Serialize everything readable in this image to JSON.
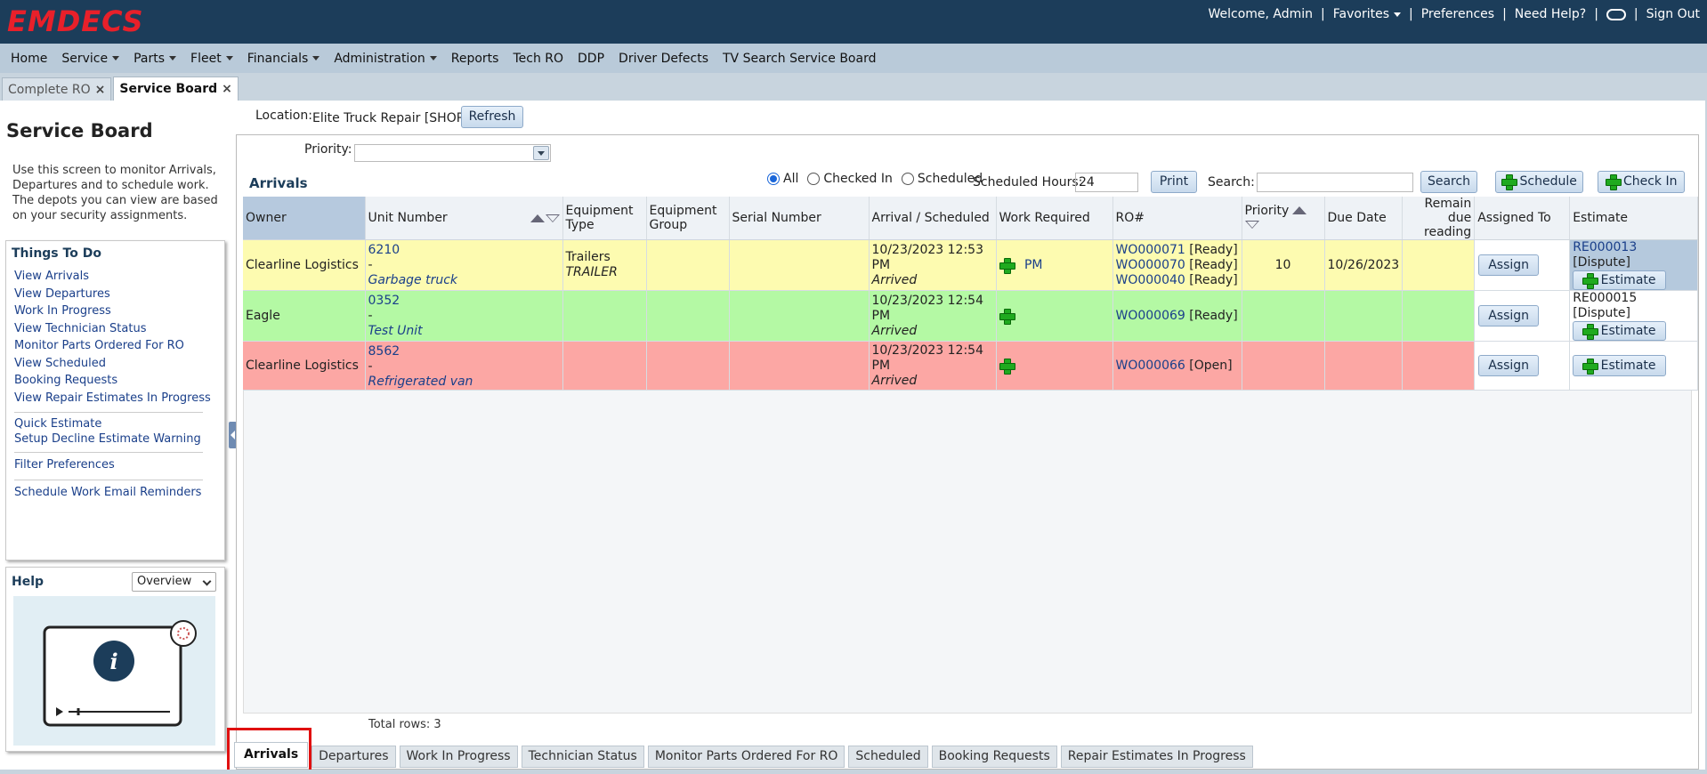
{
  "header": {
    "logo_text": "EMDECS",
    "welcome": "Welcome, Admin",
    "favorites": "Favorites",
    "preferences": "Preferences",
    "need_help": "Need Help?",
    "sign_out": "Sign Out"
  },
  "menu": {
    "home": "Home",
    "service": "Service",
    "parts": "Parts",
    "fleet": "Fleet",
    "financials": "Financials",
    "administration": "Administration",
    "reports": "Reports",
    "tech_ro": "Tech RO",
    "ddp": "DDP",
    "driver_defects": "Driver Defects",
    "tv_search": "TV Search Service Board"
  },
  "doc_tabs": {
    "complete_ro": "Complete RO",
    "service_board": "Service Board",
    "close": "×"
  },
  "left_panel": {
    "title": "Service Board",
    "description": "Use this screen to monitor Arrivals, Departures and to schedule work. The depots you can view are based on your security assignments.",
    "todo_title": "Things To Do",
    "links": {
      "view_arrivals": "View Arrivals",
      "view_departures": "View Departures",
      "work_in_progress": "Work In Progress",
      "view_tech_status": "View Technician Status",
      "monitor_parts": "Monitor Parts Ordered For RO",
      "view_scheduled": "View Scheduled",
      "booking_requests": "Booking Requests",
      "view_repair_estimates": "View Repair Estimates In Progress",
      "quick_estimate": "Quick Estimate",
      "setup_decline": "Setup Decline Estimate Warning",
      "filter_prefs": "Filter Preferences",
      "schedule_email": "Schedule Work Email Reminders"
    },
    "help_title": "Help",
    "help_select": "Overview"
  },
  "toolbar": {
    "location_label": "Location:",
    "location_value": "Elite Truck Repair [SHOP]",
    "refresh": "Refresh",
    "priority_label": "Priority:",
    "arrivals_title": "Arrivals",
    "radio_all": "All",
    "radio_checked_in": "Checked In",
    "radio_scheduled": "Scheduled",
    "scheduled_hours_label": "Scheduled Hours:",
    "scheduled_hours_value": "24",
    "print": "Print",
    "search_label": "Search:",
    "search_button": "Search",
    "schedule_button": "Schedule",
    "checkin_button": "Check In"
  },
  "table": {
    "columns": {
      "owner": "Owner",
      "unit_number": "Unit Number",
      "equipment_type": "Equipment Type",
      "equipment_group": "Equipment Group",
      "serial_number": "Serial Number",
      "arrival": "Arrival / Scheduled",
      "work_required": "Work Required",
      "ro": "RO#",
      "priority": "Priority",
      "due_date": "Due Date",
      "remain_due": "Remain due reading",
      "assigned_to": "Assigned To",
      "estimate": "Estimate"
    },
    "assign_label": "Assign",
    "estimate_label": "Estimate",
    "rows": [
      {
        "owner": "Clearline Logistics",
        "unit": "6210",
        "dash": "-",
        "unit_desc": "Garbage truck",
        "equip_type": "Trailers",
        "equip_type2": "TRAILER",
        "arrival": "10/23/2023 12:53 PM",
        "status": "Arrived",
        "work": "PM",
        "ro1": "WO000071",
        "ro1_status": "[Ready]",
        "ro2": "WO000070",
        "ro2_status": "[Ready]",
        "ro3": "WO000040",
        "ro3_status": "[Ready]",
        "priority": "10",
        "due_date": "10/26/2023",
        "est_id": "RE000013",
        "est_status": "[Dispute]"
      },
      {
        "owner": "Eagle",
        "unit": "0352",
        "dash": "-",
        "unit_desc": "Test Unit",
        "arrival": "10/23/2023 12:54 PM",
        "status": "Arrived",
        "ro1": "WO000069",
        "ro1_status": "[Ready]",
        "est_id": "RE000015",
        "est_status": "[Dispute]"
      },
      {
        "owner": "Clearline Logistics",
        "unit": "8562",
        "dash": "-",
        "unit_desc": "Refrigerated van",
        "arrival": "10/23/2023 12:54 PM",
        "status": "Arrived",
        "ro1": "WO000066",
        "ro1_status": "[Open]"
      }
    ],
    "total_rows": "Total rows:  3"
  },
  "bottom_tabs": {
    "arrivals": "Arrivals",
    "departures": "Departures",
    "work_in_progress": "Work In Progress",
    "technician_status": "Technician Status",
    "monitor_parts": "Monitor Parts Ordered For RO",
    "scheduled": "Scheduled",
    "booking_requests": "Booking Requests",
    "repair_estimates": "Repair Estimates In Progress"
  },
  "colors": {
    "header_bg": "#1c3d5a",
    "logo_red": "#e8202a",
    "row_yellow": "#fdfbb0",
    "row_green": "#b4f9a4",
    "row_red": "#fca7a4",
    "highlight": "#e01010"
  }
}
